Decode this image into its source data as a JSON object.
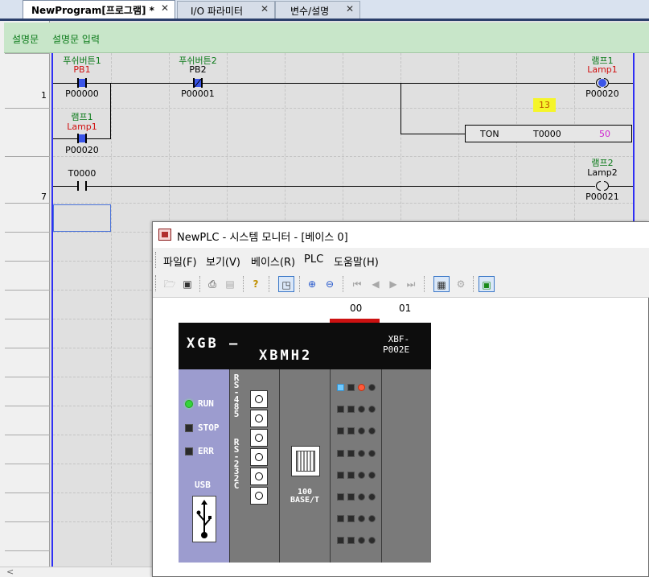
{
  "tabs": [
    {
      "label": "NewProgram[프로그램] *",
      "active": true
    },
    {
      "label": "I/O 파라미터",
      "active": false
    },
    {
      "label": "변수/설명",
      "active": false
    }
  ],
  "tab_close_glyph": "✕",
  "ladder": {
    "comment_label": "설명문",
    "comment_text": "설명문 입력",
    "rung_numbers": [
      "1",
      "7"
    ],
    "contacts": [
      {
        "name": "푸쉬버튼1",
        "var": "PB1",
        "addr": "P00000"
      },
      {
        "name": "푸쉬버튼2",
        "var": "PB2",
        "addr": "P00001"
      },
      {
        "name": "램프1",
        "var": "Lamp1",
        "addr": "P00020"
      },
      {
        "name": "",
        "var": "",
        "addr": "T0000"
      }
    ],
    "coils": [
      {
        "name": "램프1",
        "var": "Lamp1",
        "addr": "P00020"
      },
      {
        "name": "램프2",
        "var": "Lamp2",
        "addr": "P00021"
      }
    ],
    "timer": {
      "type": "TON",
      "name": "T0000",
      "preset": "50",
      "current": "13"
    },
    "scroll_left_glyph": "<"
  },
  "monitor": {
    "title": "NewPLC - 시스템 모니터 - [베이스 0]",
    "menus": [
      "파일(F)",
      "보기(V)",
      "베이스(R)",
      "PLC",
      "도움말(H)"
    ],
    "toolbar_icons": [
      "open-icon",
      "save-icon",
      "print-icon",
      "print-preview-icon",
      "help-icon",
      "monitor-icon",
      "zoom-in-icon",
      "zoom-out-icon",
      "first-icon",
      "prev-icon",
      "next-icon",
      "last-icon",
      "base-info-icon",
      "settings-icon",
      "module-icon"
    ],
    "slots": [
      "00",
      "01"
    ],
    "plc": {
      "logo_line1": "XGB —",
      "logo_line2": "XBMH2",
      "model_line1": "XBF-",
      "model_line2": "P002E",
      "leds": [
        {
          "label": "RUN",
          "on": true
        },
        {
          "label": "STOP",
          "on": false
        },
        {
          "label": "ERR",
          "on": false
        }
      ],
      "usb_label": "USB",
      "rs485_label": "RS-485",
      "rs232_label": "RS-232C",
      "eth_label_line1": "100",
      "eth_label_line2": "BASE/T"
    },
    "colors": {
      "run_led": "#35d43a",
      "slot_active": "#cc1111",
      "rail": "#2f2ff5"
    }
  }
}
